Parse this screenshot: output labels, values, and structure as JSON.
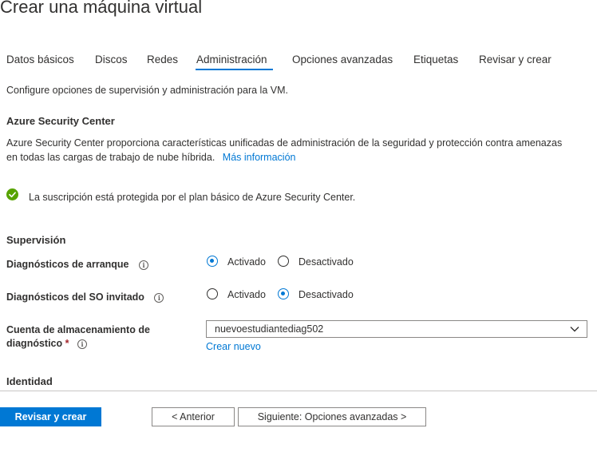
{
  "page_title": "Crear una máquina virtual",
  "tabs": [
    {
      "label": "Datos básicos",
      "active": false
    },
    {
      "label": "Discos",
      "active": false
    },
    {
      "label": "Redes",
      "active": false
    },
    {
      "label": "Administración",
      "active": true
    },
    {
      "label": "Opciones avanzadas",
      "active": false
    },
    {
      "label": "Etiquetas",
      "active": false
    },
    {
      "label": "Revisar y crear",
      "active": false
    }
  ],
  "description": "Configure opciones de supervisión y administración para la VM.",
  "security_center": {
    "heading": "Azure Security Center",
    "text_line1": "Azure Security Center proporciona características unificadas de administración de la seguridad y protección contra amenazas",
    "text_line2": "en todas las cargas de trabajo de nube híbrida.",
    "link": "Más información",
    "status_text": "La suscripción está protegida por el plan básico de Azure Security Center."
  },
  "monitoring": {
    "heading": "Supervisión",
    "boot_diagnostics": {
      "label": "Diagnósticos de arranque",
      "option_on": "Activado",
      "option_off": "Desactivado",
      "selected": "Activado"
    },
    "guest_os_diagnostics": {
      "label": "Diagnósticos del SO invitado",
      "option_on": "Activado",
      "option_off": "Desactivado",
      "selected": "Desactivado"
    },
    "storage_account": {
      "label_line1": "Cuenta de almacenamiento de",
      "label_line2": "diagnóstico",
      "required_mark": "*",
      "value": "nuevoestudiantediag502",
      "create_new": "Crear nuevo"
    }
  },
  "identity": {
    "heading": "Identidad"
  },
  "footer": {
    "review_create": "Revisar y crear",
    "previous": "< Anterior",
    "next": "Siguiente: Opciones avanzadas >"
  },
  "colors": {
    "accent": "#0078d4",
    "success": "#57a300",
    "text": "#323130"
  },
  "icons": {
    "info": "info-icon",
    "success": "checkmark-circle-icon",
    "dropdown": "chevron-down-icon"
  }
}
